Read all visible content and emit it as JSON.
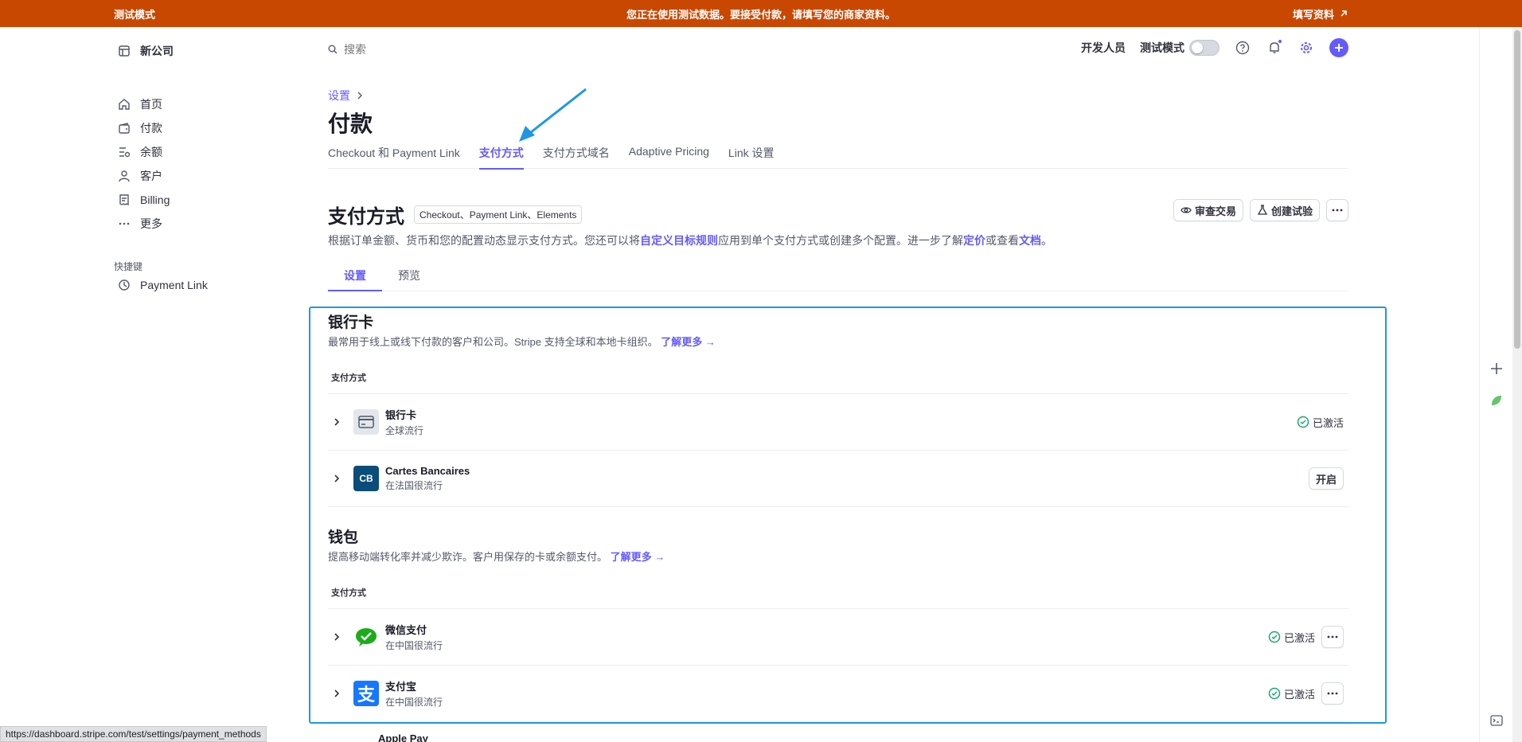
{
  "banner": {
    "mode": "测试模式",
    "message": "您正在使用测试数据。要接受付款，请填写您的商家资料。",
    "action": "填写资料"
  },
  "sidebar": {
    "company": "新公司",
    "items": [
      {
        "label": "首页",
        "icon": "home-icon"
      },
      {
        "label": "付款",
        "icon": "wallet-icon"
      },
      {
        "label": "余额",
        "icon": "balance-icon"
      },
      {
        "label": "客户",
        "icon": "person-icon"
      },
      {
        "label": "Billing",
        "icon": "billing-icon"
      },
      {
        "label": "更多",
        "icon": "more-icon"
      }
    ],
    "shortcuts_title": "快捷键",
    "shortcut": "Payment Link"
  },
  "header": {
    "search_placeholder": "搜索",
    "developers": "开发人员",
    "test_mode": "测试模式"
  },
  "page": {
    "breadcrumb": "设置",
    "title": "付款",
    "tabs": [
      "Checkout 和 Payment Link",
      "支付方式",
      "支付方式域名",
      "Adaptive Pricing",
      "Link 设置"
    ],
    "active_tab": 1
  },
  "section": {
    "title": "支付方式",
    "pill": "Checkout、Payment Link、Elements",
    "review_btn": "审查交易",
    "experiment_btn": "创建试验",
    "desc_1": "根据订单金额、货币和您的配置动态显示支付方式。您还可以将",
    "desc_link_1": "自定义目标规则",
    "desc_2": "应用到单个支付方式或创建多个配置。进一步了解",
    "desc_link_2": "定价",
    "desc_3": "或查看",
    "desc_link_3": "文档",
    "desc_4": "。",
    "subtabs": [
      "设置",
      "预览"
    ]
  },
  "cards": {
    "title": "银行卡",
    "desc": "最常用于线上或线下付款的客户和公司。Stripe 支持全球和本地卡组织。",
    "learn": "了解更多 →",
    "col": "支付方式",
    "rows": [
      {
        "name": "银行卡",
        "sub": "全球流行",
        "status": "已激活"
      },
      {
        "name": "Cartes Bancaires",
        "sub": "在法国很流行",
        "action": "开启",
        "logo_text": "CB"
      }
    ]
  },
  "wallets": {
    "title": "钱包",
    "desc": "提高移动端转化率并减少欺诈。客户用保存的卡或余额支付。",
    "learn": "了解更多 →",
    "col": "支付方式",
    "rows": [
      {
        "name": "微信支付",
        "sub": "在中国很流行",
        "status": "已激活"
      },
      {
        "name": "支付宝",
        "sub": "在中国很流行",
        "status": "已激活",
        "logo_text": "支"
      }
    ],
    "peek": "Apple Pay"
  },
  "url": "https://dashboard.stripe.com/test/settings/payment_methods",
  "colors": {
    "banner": "#c84801",
    "accent": "#635bff",
    "frame": "#1e98e4",
    "success": "#1ea672"
  }
}
